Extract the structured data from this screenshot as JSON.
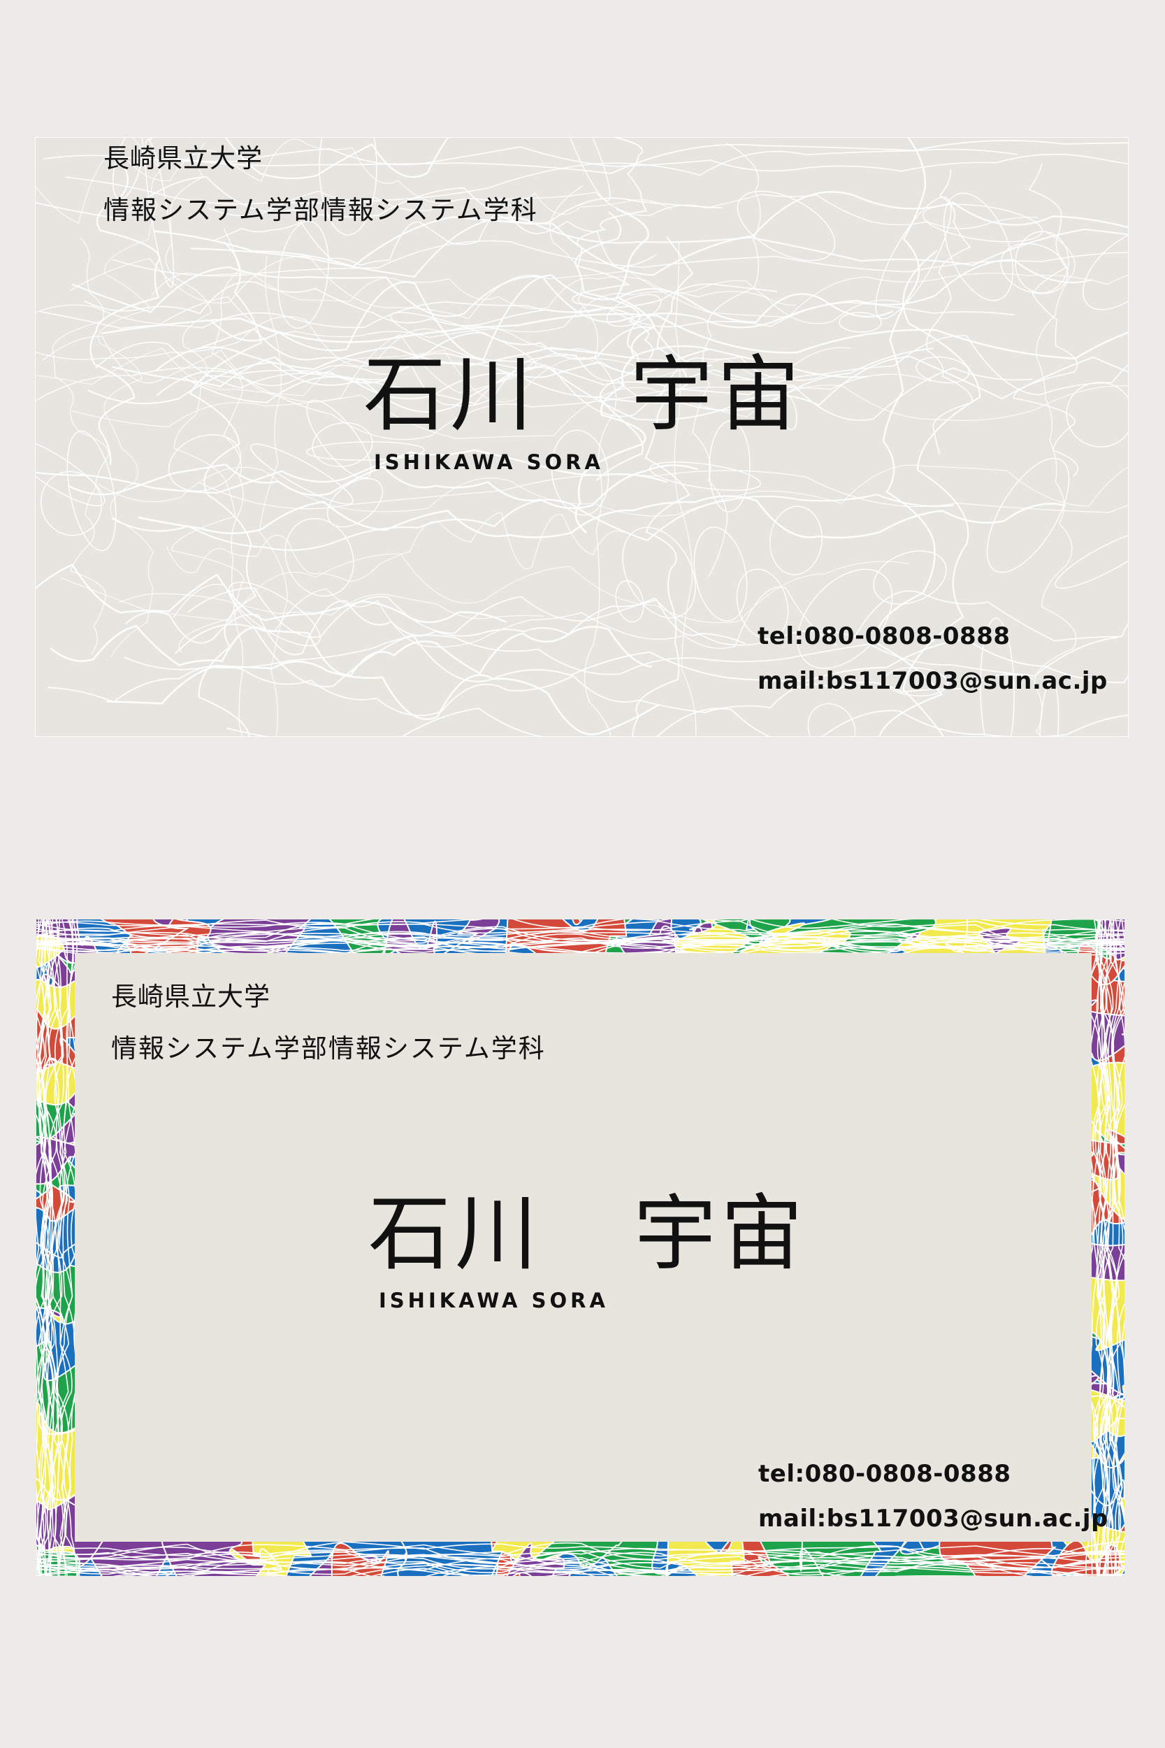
{
  "cards": [
    {
      "university": "長崎県立大学",
      "department": "情報システム学部情報システム学科",
      "name_family": "石川",
      "name_given": "宇宙",
      "name_roman": "ISHIKAWA SORA",
      "tel": "tel:080-0808-0888",
      "mail": "mail:bs117003@sun.ac.jp",
      "style": "white-contour-lines"
    },
    {
      "university": "長崎県立大学",
      "department": "情報システム学部情報システム学科",
      "name_family": "石川",
      "name_given": "宇宙",
      "name_roman": "ISHIKAWA SORA",
      "tel": "tel:080-0808-0888",
      "mail": "mail:bs117003@sun.ac.jp",
      "style": "colorful-border"
    }
  ],
  "colors": {
    "page_background": "#ecebe7",
    "card_background": "#e7e5df",
    "text": "#111111",
    "border_palette": [
      "#1a6fbf",
      "#7b3f98",
      "#d44a3a",
      "#1fa34a",
      "#f2e94e",
      "#ffffff"
    ]
  }
}
